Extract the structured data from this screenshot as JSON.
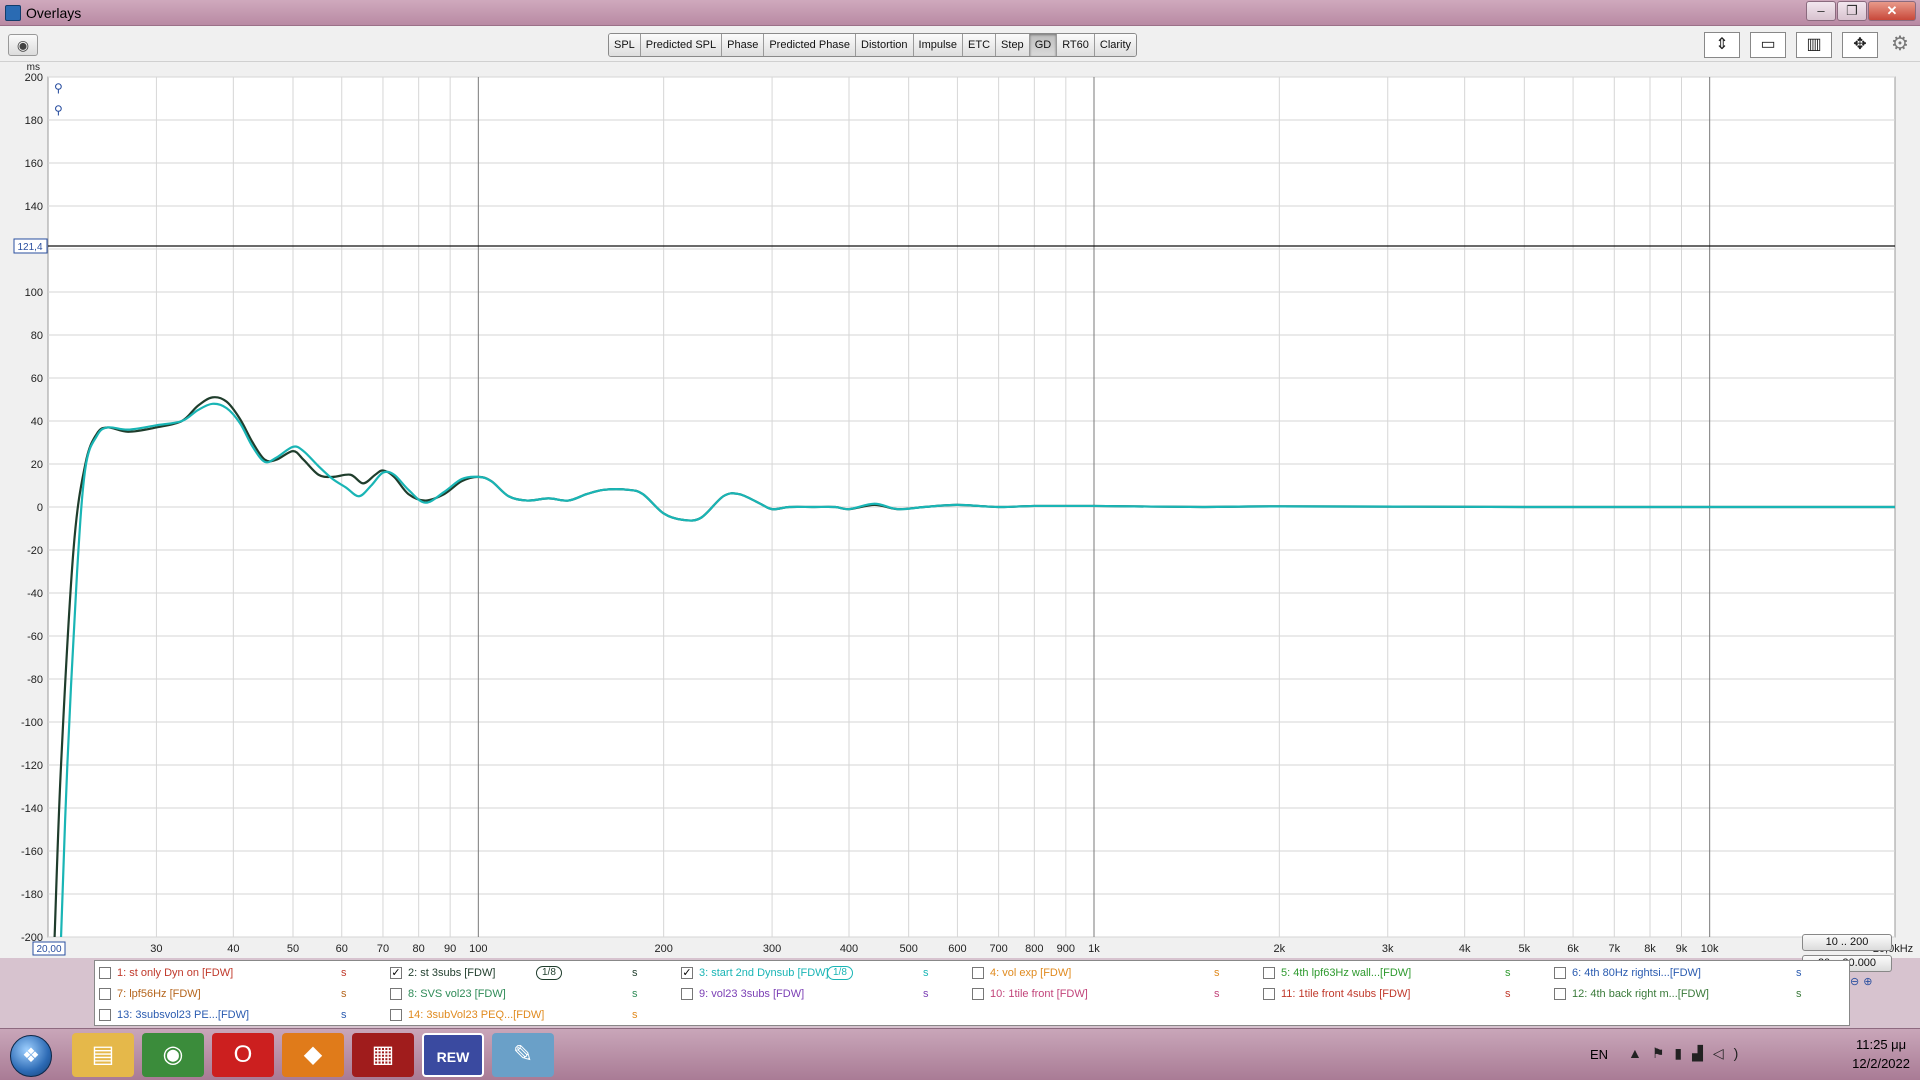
{
  "window": {
    "title": "Overlays"
  },
  "toolbar": {
    "tabs": [
      {
        "label": "SPL",
        "active": false
      },
      {
        "label": "Predicted SPL",
        "active": false
      },
      {
        "label": "Phase",
        "active": false
      },
      {
        "label": "Predicted Phase",
        "active": false
      },
      {
        "label": "Distortion",
        "active": false
      },
      {
        "label": "Impulse",
        "active": false
      },
      {
        "label": "ETC",
        "active": false
      },
      {
        "label": "Step",
        "active": false
      },
      {
        "label": "GD",
        "active": true
      },
      {
        "label": "RT60",
        "active": false
      },
      {
        "label": "Clarity",
        "active": false
      }
    ]
  },
  "chart_data": {
    "type": "line",
    "y_unit": "ms",
    "ylim": [
      -200,
      200
    ],
    "xlim": [
      20,
      20000
    ],
    "x_scale": "log",
    "y_ticks": [
      200,
      180,
      160,
      140,
      100,
      80,
      60,
      40,
      20,
      0,
      -20,
      -40,
      -60,
      -80,
      -100,
      -120,
      -140,
      -160,
      -180,
      -200
    ],
    "cursor_y_label": "121,4",
    "cursor_y_value": 121.4,
    "x_start_label": "20,00",
    "x_ticks": [
      {
        "v": 30,
        "label": "30"
      },
      {
        "v": 40,
        "label": "40"
      },
      {
        "v": 50,
        "label": "50"
      },
      {
        "v": 60,
        "label": "60"
      },
      {
        "v": 70,
        "label": "70"
      },
      {
        "v": 80,
        "label": "80"
      },
      {
        "v": 90,
        "label": "90"
      },
      {
        "v": 100,
        "label": "100"
      },
      {
        "v": 200,
        "label": "200"
      },
      {
        "v": 300,
        "label": "300"
      },
      {
        "v": 400,
        "label": "400"
      },
      {
        "v": 500,
        "label": "500"
      },
      {
        "v": 600,
        "label": "600"
      },
      {
        "v": 700,
        "label": "700"
      },
      {
        "v": 800,
        "label": "800"
      },
      {
        "v": 900,
        "label": "900"
      },
      {
        "v": 1000,
        "label": "1k"
      },
      {
        "v": 2000,
        "label": "2k"
      },
      {
        "v": 3000,
        "label": "3k"
      },
      {
        "v": 4000,
        "label": "4k"
      },
      {
        "v": 5000,
        "label": "5k"
      },
      {
        "v": 6000,
        "label": "6k"
      },
      {
        "v": 7000,
        "label": "7k"
      },
      {
        "v": 8000,
        "label": "8k"
      },
      {
        "v": 9000,
        "label": "9k"
      },
      {
        "v": 10000,
        "label": "10k"
      },
      {
        "v": 20000,
        "label": "20,0kHz"
      }
    ],
    "grid": true,
    "series": [
      {
        "name": "2: st 3subs [FDW]",
        "color": "#1f3d2c",
        "points": [
          [
            20.5,
            -200
          ],
          [
            21,
            -120
          ],
          [
            22,
            -20
          ],
          [
            23,
            20
          ],
          [
            24,
            34
          ],
          [
            25,
            37
          ],
          [
            27,
            35
          ],
          [
            30,
            37
          ],
          [
            33,
            40
          ],
          [
            35,
            47
          ],
          [
            37,
            51
          ],
          [
            39,
            49
          ],
          [
            41,
            41
          ],
          [
            43,
            30
          ],
          [
            45,
            22
          ],
          [
            47,
            22
          ],
          [
            50,
            26
          ],
          [
            52,
            22
          ],
          [
            55,
            15
          ],
          [
            58,
            14
          ],
          [
            62,
            15
          ],
          [
            65,
            11
          ],
          [
            68,
            15
          ],
          [
            70,
            17
          ],
          [
            73,
            14
          ],
          [
            77,
            6
          ],
          [
            82,
            3
          ],
          [
            88,
            6
          ],
          [
            94,
            12
          ],
          [
            100,
            14
          ],
          [
            105,
            12
          ],
          [
            112,
            5
          ],
          [
            120,
            3
          ],
          [
            130,
            4
          ],
          [
            140,
            3
          ],
          [
            150,
            6
          ],
          [
            160,
            8
          ],
          [
            175,
            8
          ],
          [
            185,
            6
          ],
          [
            200,
            -3
          ],
          [
            215,
            -6
          ],
          [
            230,
            -5
          ],
          [
            250,
            5
          ],
          [
            265,
            6
          ],
          [
            285,
            2
          ],
          [
            300,
            -1
          ],
          [
            320,
            0
          ],
          [
            350,
            0
          ],
          [
            380,
            0
          ],
          [
            400,
            -1
          ],
          [
            440,
            1
          ],
          [
            480,
            -1
          ],
          [
            530,
            0
          ],
          [
            600,
            1
          ],
          [
            700,
            0
          ],
          [
            800,
            0.5
          ],
          [
            1000,
            0.5
          ],
          [
            1500,
            0
          ],
          [
            2000,
            0.3
          ],
          [
            5000,
            0
          ],
          [
            10000,
            0
          ],
          [
            20000,
            0
          ]
        ]
      },
      {
        "name": "3: start 2nd Dynsub [FDW]",
        "color": "#19b5b5",
        "points": [
          [
            21,
            -200
          ],
          [
            21.5,
            -120
          ],
          [
            22.3,
            -30
          ],
          [
            23,
            18
          ],
          [
            24,
            33
          ],
          [
            25,
            37
          ],
          [
            27,
            36
          ],
          [
            30,
            38
          ],
          [
            33,
            40
          ],
          [
            35,
            45
          ],
          [
            37,
            48
          ],
          [
            39,
            46
          ],
          [
            41,
            39
          ],
          [
            43,
            28
          ],
          [
            45,
            21
          ],
          [
            47,
            23
          ],
          [
            50,
            28
          ],
          [
            52,
            26
          ],
          [
            55,
            19
          ],
          [
            58,
            13
          ],
          [
            61,
            9
          ],
          [
            64,
            5
          ],
          [
            67,
            10
          ],
          [
            70,
            16
          ],
          [
            73,
            15
          ],
          [
            77,
            8
          ],
          [
            82,
            2
          ],
          [
            88,
            7
          ],
          [
            94,
            13
          ],
          [
            100,
            14
          ],
          [
            105,
            12
          ],
          [
            112,
            5
          ],
          [
            120,
            3
          ],
          [
            130,
            4
          ],
          [
            140,
            3
          ],
          [
            150,
            6
          ],
          [
            160,
            8
          ],
          [
            175,
            8
          ],
          [
            185,
            6
          ],
          [
            200,
            -3
          ],
          [
            215,
            -6
          ],
          [
            230,
            -5
          ],
          [
            250,
            5
          ],
          [
            265,
            6
          ],
          [
            285,
            2
          ],
          [
            300,
            -1
          ],
          [
            320,
            0
          ],
          [
            350,
            0
          ],
          [
            380,
            0
          ],
          [
            400,
            -1
          ],
          [
            440,
            1.5
          ],
          [
            480,
            -1
          ],
          [
            530,
            0
          ],
          [
            600,
            1
          ],
          [
            700,
            0
          ],
          [
            800,
            0.5
          ],
          [
            1000,
            0.5
          ],
          [
            1500,
            0
          ],
          [
            2000,
            0.3
          ],
          [
            5000,
            0
          ],
          [
            10000,
            0
          ],
          [
            20000,
            0
          ]
        ]
      }
    ]
  },
  "overlay_list": {
    "rows": [
      [
        {
          "label": "1: st only Dyn on [FDW]",
          "checked": false,
          "color": "#c0392b",
          "smoothing": "",
          "flag": "s"
        },
        {
          "label": "2: st 3subs [FDW]",
          "checked": true,
          "color": "#1f3d2c",
          "smoothing": "1/8",
          "flag": "s"
        },
        {
          "label": "3: start 2nd Dynsub [FDW]",
          "checked": true,
          "color": "#19b5b5",
          "smoothing": "1/8",
          "flag": "s"
        },
        {
          "label": "4: vol exp [FDW]",
          "checked": false,
          "color": "#e08a1e",
          "smoothing": "",
          "flag": "s"
        },
        {
          "label": "5: 4th lpf63Hz wall...[FDW]",
          "checked": false,
          "color": "#2e9a2e",
          "smoothing": "",
          "flag": "s"
        },
        {
          "label": "6: 4th 80Hz rightsi...[FDW]",
          "checked": false,
          "color": "#2a5bb0",
          "smoothing": "",
          "flag": "s"
        }
      ],
      [
        {
          "label": "7: lpf56Hz [FDW]",
          "checked": false,
          "color": "#b5651d",
          "smoothing": "",
          "flag": "s"
        },
        {
          "label": "8: SVS vol23 [FDW]",
          "checked": false,
          "color": "#2e8b57",
          "smoothing": "",
          "flag": "s"
        },
        {
          "label": "9: vol23 3subs [FDW]",
          "checked": false,
          "color": "#7b3fb5",
          "smoothing": "",
          "flag": "s"
        },
        {
          "label": "10: 1tile front [FDW]",
          "checked": false,
          "color": "#c2447a",
          "smoothing": "",
          "flag": "s"
        },
        {
          "label": "11: 1tile front 4subs [FDW]",
          "checked": false,
          "color": "#c0392b",
          "smoothing": "",
          "flag": "s"
        },
        {
          "label": "12: 4th back right m...[FDW]",
          "checked": false,
          "color": "#3a7a3a",
          "smoothing": "",
          "flag": "s"
        }
      ],
      [
        {
          "label": "13: 3subsvol23  PE...[FDW]",
          "checked": false,
          "color": "#2a5bb0",
          "smoothing": "",
          "flag": "s"
        },
        {
          "label": "14: 3subVol23 PEQ...[FDW]",
          "checked": false,
          "color": "#e08a1e",
          "smoothing": "",
          "flag": "s"
        }
      ]
    ]
  },
  "range_buttons": [
    "10 .. 200",
    "20 .. 20.000"
  ],
  "taskbar": {
    "lang": "EN",
    "time": "11:25 μμ",
    "date": "12/2/2022",
    "apps": [
      {
        "name": "explorer",
        "icon": "▤",
        "color": "#e5b84a"
      },
      {
        "name": "chrome",
        "icon": "◉",
        "color": "#3b8c3b"
      },
      {
        "name": "opera",
        "icon": "O",
        "color": "#cc1f1f"
      },
      {
        "name": "brave",
        "icon": "◆",
        "color": "#e07b1a"
      },
      {
        "name": "app-red",
        "icon": "▦",
        "color": "#a01c1c"
      },
      {
        "name": "rew",
        "icon": "REW",
        "color": "#3a4aa0"
      },
      {
        "name": "paint",
        "icon": "✎",
        "color": "#6aa0c8"
      }
    ]
  }
}
